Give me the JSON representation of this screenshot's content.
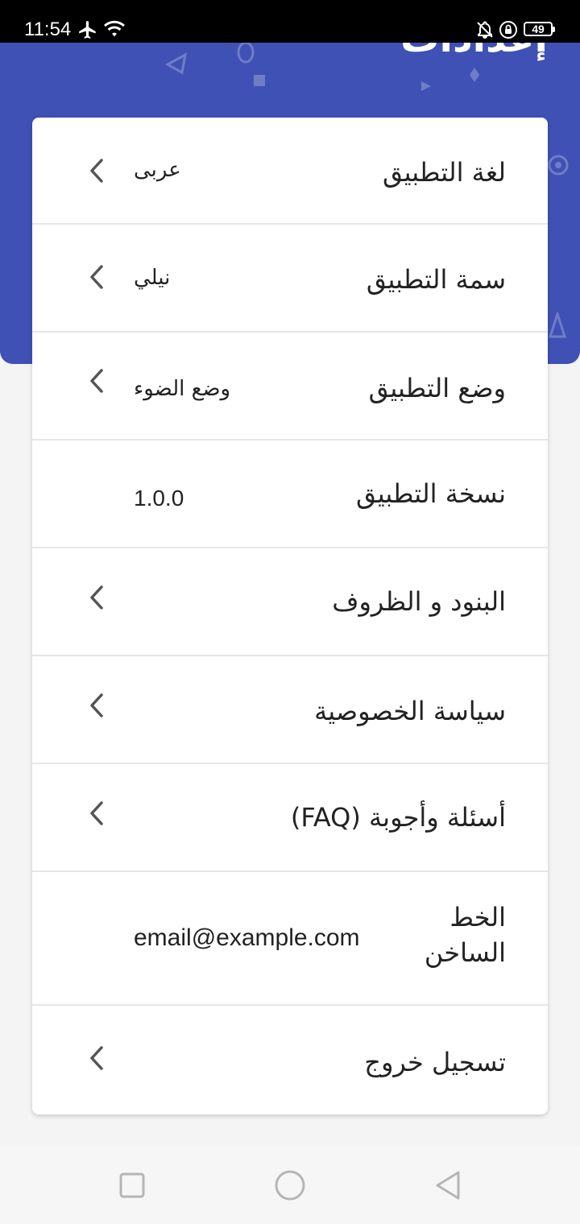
{
  "status_bar": {
    "time": "11:54",
    "battery": "49",
    "icons": [
      "airplane-icon",
      "wifi-icon",
      "bell-off-icon",
      "lock-rotation-icon",
      "battery-icon"
    ]
  },
  "header": {
    "title": "إعدادات",
    "color": "#3f51b5"
  },
  "settings": [
    {
      "id": "language",
      "label": "لغة التطبيق",
      "value": "عربى",
      "chevron": true
    },
    {
      "id": "theme",
      "label": "سمة التطبيق",
      "value": "نيلي",
      "chevron": true
    },
    {
      "id": "mode",
      "label": "وضع التطبيق",
      "value": "وضع الضوء",
      "chevron": true
    },
    {
      "id": "version",
      "label": "نسخة التطبيق",
      "value": "1.0.0",
      "chevron": false
    },
    {
      "id": "terms",
      "label": "البنود و الظروف",
      "value": "",
      "chevron": true
    },
    {
      "id": "privacy",
      "label": "سياسة الخصوصية",
      "value": "",
      "chevron": true
    },
    {
      "id": "faq",
      "label": "أسئلة وأجوبة (FAQ)",
      "value": "",
      "chevron": true
    },
    {
      "id": "hotline",
      "label": "الخط الساخن",
      "value": "email@example.com",
      "chevron": false
    },
    {
      "id": "logout",
      "label": "تسجيل خروج",
      "value": "",
      "chevron": true
    }
  ],
  "nav_bar": {
    "buttons": [
      "recent-apps-icon",
      "home-icon",
      "back-icon"
    ]
  }
}
